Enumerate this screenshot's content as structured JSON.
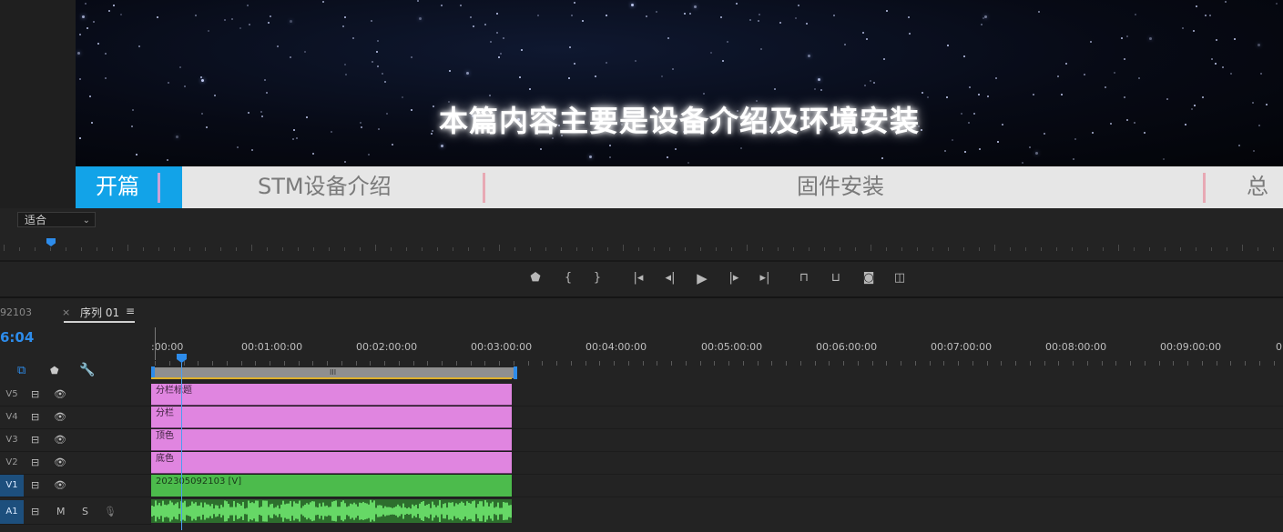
{
  "monitor": {
    "caption": "本篇内容主要是设备介绍及环境安装",
    "chapters": [
      "开篇",
      "STM设备介绍",
      "固件安装",
      "总结"
    ],
    "zoom": "适合"
  },
  "transport": {
    "buttons": [
      "add-marker",
      "mark-in",
      "mark-out",
      "go-to-in",
      "step-back",
      "play",
      "step-forward",
      "go-to-out",
      "lift",
      "extract",
      "export-frame",
      "compare"
    ]
  },
  "timeline": {
    "tab_clip": "92103",
    "tab_close": "×",
    "sequence_tab": "序列 01",
    "menu_glyph": "≡",
    "timecode": "6:04",
    "ruler_labels": [
      ":00:00",
      "00:01:00:00",
      "00:02:00:00",
      "00:03:00:00",
      "00:04:00:00",
      "00:05:00:00",
      "00:06:00:00",
      "00:07:00:00",
      "00:08:00:00",
      "00:09:00:00",
      "0"
    ],
    "work_area_grip": "III",
    "tracks": [
      {
        "name": "V5",
        "clip": "分栏标题"
      },
      {
        "name": "V4",
        "clip": "分栏"
      },
      {
        "name": "V3",
        "clip": "顶色"
      },
      {
        "name": "V2",
        "clip": "底色"
      },
      {
        "name": "V1",
        "clip": "202305092103 [V]"
      }
    ],
    "audio_track": {
      "name": "A1",
      "mute": "M",
      "solo": "S"
    },
    "icons": {
      "sync": "⊟",
      "eye": "👁",
      "marker": "⬟",
      "wrench": "🔧",
      "mic": "🎙"
    }
  },
  "colors": {
    "accent": "#2d8ceb",
    "chapter_active": "#12a3e8",
    "graphic_clip": "#e085e0",
    "video_clip": "#4cbb4c",
    "work_area": "#8f8f8f"
  }
}
